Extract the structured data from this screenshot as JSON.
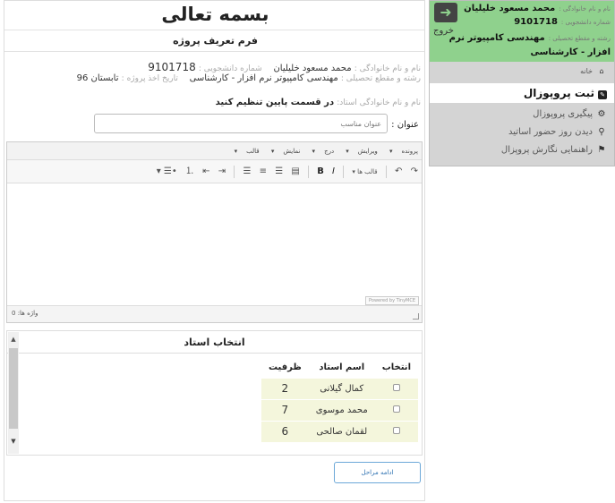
{
  "header": {
    "bismillah": "بسمه تعالی",
    "form_title": "فرم تعریف پروژه"
  },
  "student_info": {
    "name_label": "نام و نام خانوادگی :",
    "name_value": "محمد مسعود خلیلیان",
    "id_label": "شماره دانشجویی :",
    "id_value": "9101718",
    "major_label": "رشته و مقطع تحصیلی :",
    "major_value": "مهندسی کامپیوتر نرم افزار - کارشناسی",
    "date_label": "تاریخ اخذ پروژه :",
    "date_value": "تابستان 96",
    "advisor_label": "نام و نام خانوادگی استاد:",
    "advisor_value": "در قسمت پایین تنظیم کنید"
  },
  "title_field": {
    "label": "عنوان :",
    "placeholder": "عنوان مناسب"
  },
  "editor": {
    "menu": [
      "پرونده",
      "ویرایش",
      "درج",
      "نمایش",
      "قالب"
    ],
    "format_label": "قالب ها",
    "powered_by": "Powered by TinyMCE",
    "word_count": "واژه ها: 0"
  },
  "teacher_section": {
    "title": "انتخاب استاد",
    "columns": {
      "select": "انتخاب",
      "name": "اسم استاد",
      "capacity": "ظرفیت"
    },
    "rows": [
      {
        "name": "کمال گیلانی",
        "capacity": "2"
      },
      {
        "name": "محمد موسوی",
        "capacity": "7"
      },
      {
        "name": "لقمان صالحی",
        "capacity": "6"
      }
    ]
  },
  "next_button": "ادامه مراحل",
  "sidebar": {
    "logout": "خروج",
    "profile": {
      "name_label": "نام و نام خانوادگی :",
      "name": "محمد مسعود خلیلیان",
      "id_label": "شماره دانشجویی :",
      "id": "9101718",
      "major_label": "رشته و مقطع تحصیلی :",
      "major_line1": "مهندسی کامپیوتر نرم",
      "major_line2": "افزار - کارشناسی"
    },
    "nav": {
      "home": "خانه",
      "register": "ثبت پروپوزال",
      "followup": "پیگیری پروپوزال",
      "office_hours": "دیدن روز حضور اساتید",
      "guide": "راهنمایی نگارش پروپزال"
    }
  },
  "colors": {
    "profile_bg": "#8fd18d",
    "sidebar_bg": "#d4d4d4",
    "table_row_bg": "#f4f6dc",
    "button_border": "#6ca8d8"
  },
  "icons": [
    "logout-icon",
    "home-icon",
    "edit-icon",
    "gear-icon",
    "binoculars-icon",
    "signpost-icon"
  ]
}
